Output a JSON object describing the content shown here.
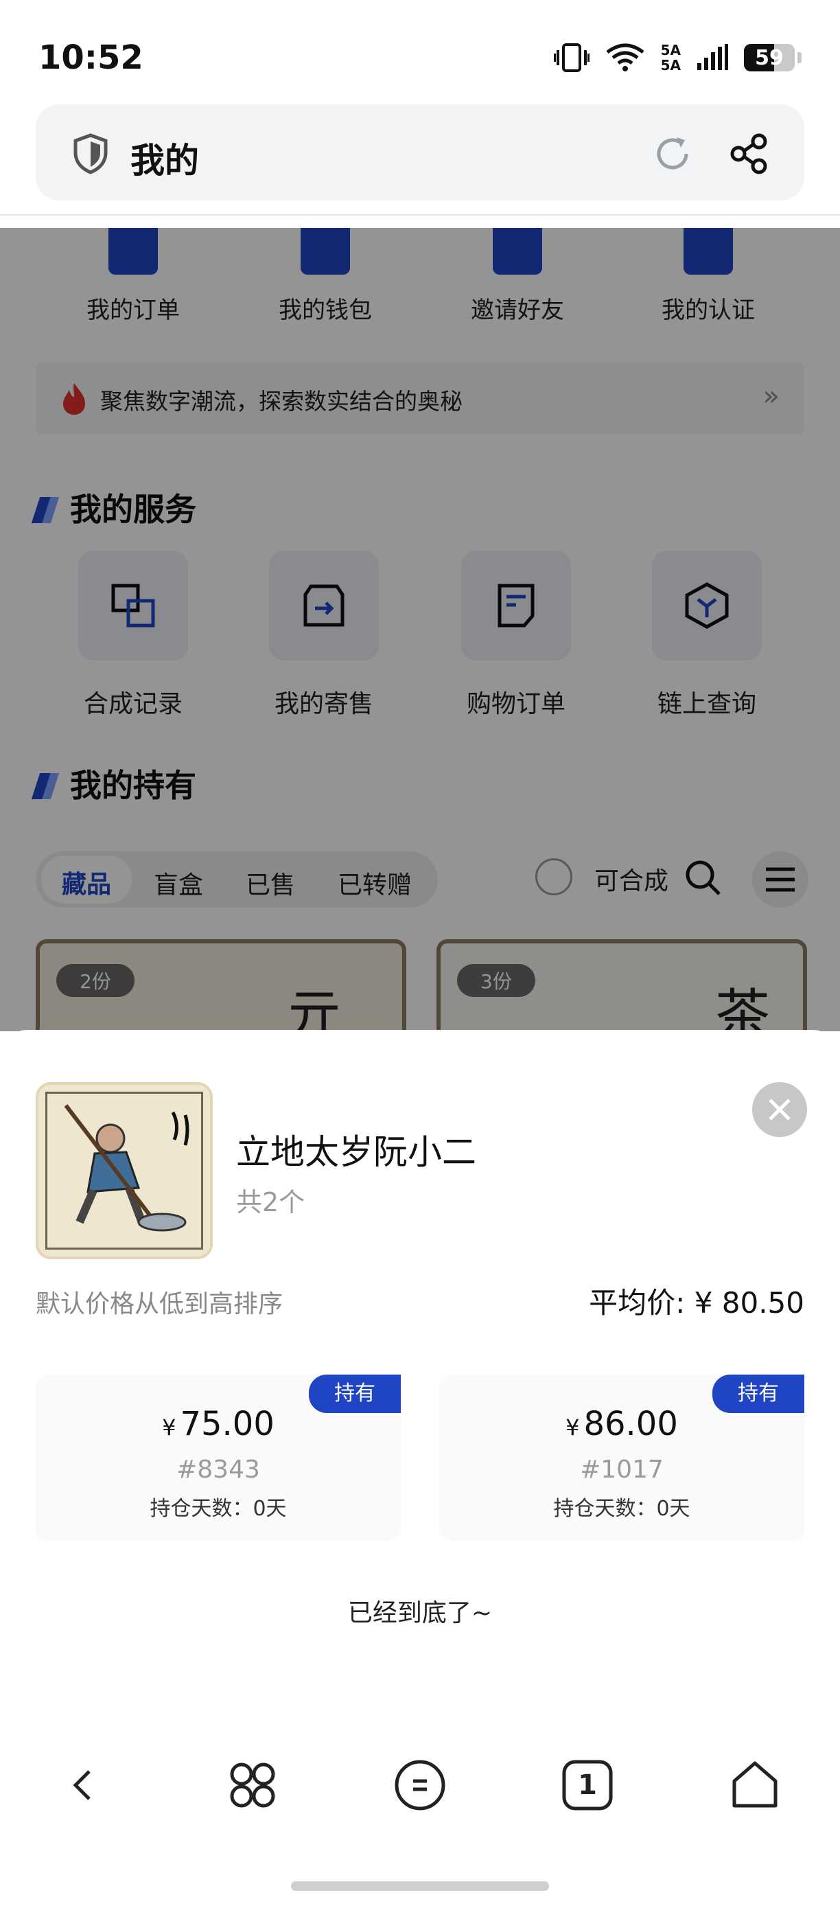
{
  "status_bar": {
    "time": "10:52",
    "network_top": "5A",
    "network_bottom": "5A",
    "battery": "59",
    "battery_level": 0.59,
    "icons": [
      "vibrate-icon",
      "wifi-icon",
      "signal-icon",
      "battery-icon"
    ]
  },
  "address_bar": {
    "title": "我的",
    "icons": [
      "shield-icon",
      "reload-icon",
      "share-icon"
    ]
  },
  "quick_links": [
    {
      "label": "我的订单",
      "icon": "order-icon"
    },
    {
      "label": "我的钱包",
      "icon": "wallet-icon"
    },
    {
      "label": "邀请好友",
      "icon": "invite-icon"
    },
    {
      "label": "我的认证",
      "icon": "verify-icon"
    }
  ],
  "banner": {
    "text": "聚焦数字潮流，探索数实结合的奥秘",
    "arrow": "»",
    "icon": "flame-icon"
  },
  "services": {
    "title": "我的服务",
    "items": [
      {
        "label": "合成记录",
        "icon": "synthesis-record-icon"
      },
      {
        "label": "我的寄售",
        "icon": "consignment-icon"
      },
      {
        "label": "购物订单",
        "icon": "shopping-order-icon"
      },
      {
        "label": "链上查询",
        "icon": "chain-query-icon"
      }
    ]
  },
  "holdings": {
    "title": "我的持有",
    "tabs": [
      "藏品",
      "盲盒",
      "已售",
      "已转赠"
    ],
    "active_tab": "藏品",
    "synth_label": "可合成",
    "cards": [
      {
        "count": "2份",
        "art": "亓"
      },
      {
        "count": "3份",
        "art": "茶"
      }
    ]
  },
  "sheet": {
    "item_title": "立地太岁阮小二",
    "item_count": "共2个",
    "sort_note": "默认价格从低到高排序",
    "avg_price_label": "平均价:",
    "avg_price": "¥ 80.50",
    "thumb_text": "立地太岁阮小二",
    "listings": [
      {
        "badge": "持有",
        "currency": "¥",
        "price": "75.00",
        "serial": "#8343",
        "hold_days": "持仓天数：0天"
      },
      {
        "badge": "持有",
        "currency": "¥",
        "price": "86.00",
        "serial": "#1017",
        "hold_days": "持仓天数：0天"
      }
    ],
    "end_note": "已经到底了~"
  },
  "nav": {
    "tab_count": "1",
    "icons": [
      "back-icon",
      "apps-icon",
      "menu-icon",
      "tabs-icon",
      "home-icon"
    ]
  },
  "colors": {
    "accent": "#1f45c4",
    "overlay": "rgba(0,0,0,0.42)",
    "flame": "#e2332b"
  }
}
